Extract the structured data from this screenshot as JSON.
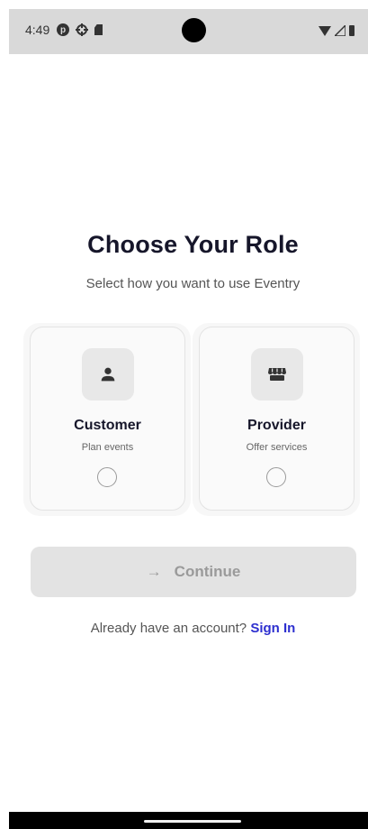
{
  "status_bar": {
    "time": "4:49",
    "left_icons": [
      "pinterest-icon",
      "settings-icon",
      "sd-card-icon"
    ],
    "right_icons": [
      "wifi-icon",
      "signal-icon",
      "battery-icon"
    ]
  },
  "heading": {
    "title": "Choose Your Role",
    "subtitle": "Select how you want to use Eventry"
  },
  "roles": [
    {
      "title": "Customer",
      "description": "Plan events",
      "icon": "person-icon",
      "selected": false
    },
    {
      "title": "Provider",
      "description": "Offer services",
      "icon": "storefront-icon",
      "selected": false
    }
  ],
  "continue_button": {
    "label": "Continue",
    "icon": "arrow-right-icon",
    "enabled": false
  },
  "signin": {
    "prompt": "Already have an account?",
    "link": "Sign In"
  },
  "colors": {
    "accent": "#2d2fcf",
    "title_text": "#16162a",
    "button_disabled": "#e3e3e3",
    "status_bar_bg": "#d9d9d9"
  }
}
